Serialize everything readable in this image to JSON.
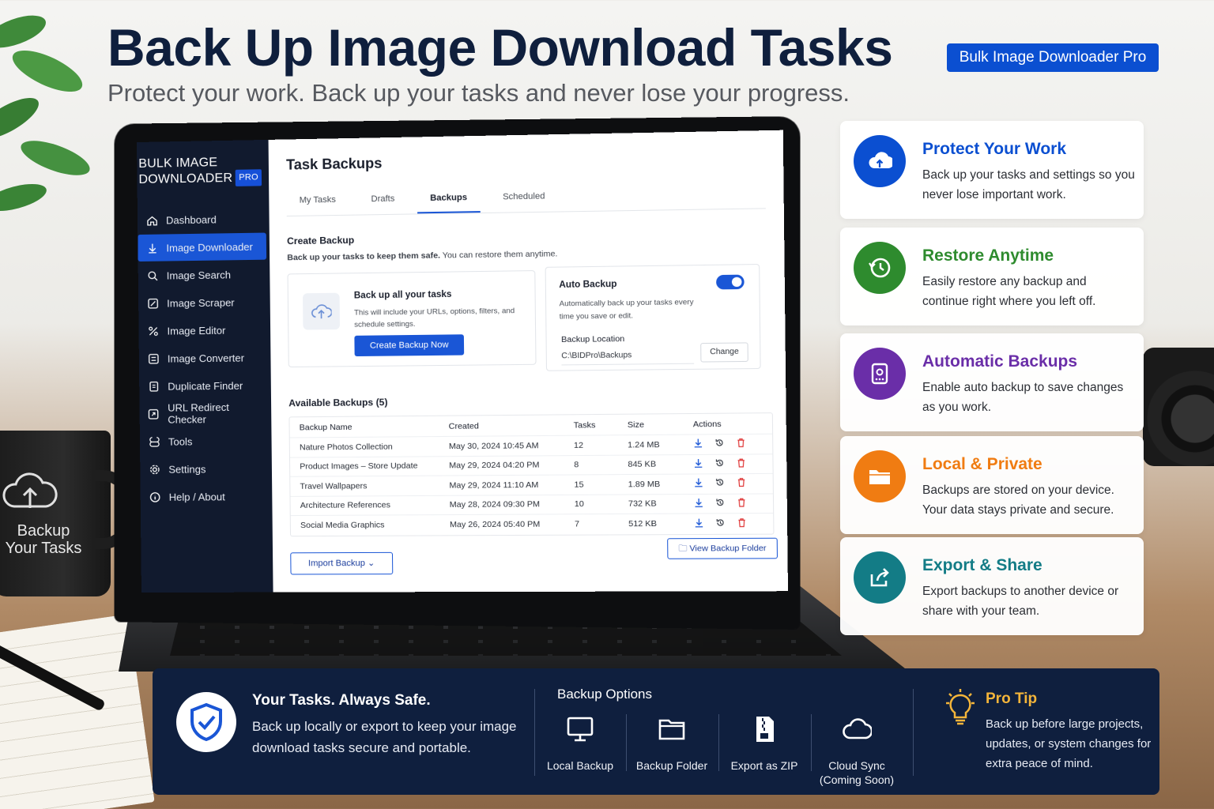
{
  "hero": {
    "title": "Back Up Image Download Tasks",
    "subtitle": "Protect your work. Back up your tasks and never lose your progress.",
    "badge": "Bulk Image Downloader Pro"
  },
  "mug": {
    "text_line1": "Backup",
    "text_line2": "Your Tasks"
  },
  "app": {
    "logo_line1": "BULK IMAGE",
    "logo_line2": "DOWNLOADER",
    "logo_badge": "PRO",
    "nav": [
      {
        "label": "Dashboard",
        "icon": "home-icon"
      },
      {
        "label": "Image Downloader",
        "icon": "download-icon",
        "active": true
      },
      {
        "label": "Image Search",
        "icon": "search-icon"
      },
      {
        "label": "Image Scraper",
        "icon": "scraper-icon"
      },
      {
        "label": "Image Editor",
        "icon": "editor-icon"
      },
      {
        "label": "Image Converter",
        "icon": "converter-icon"
      },
      {
        "label": "Duplicate Finder",
        "icon": "duplicate-icon"
      },
      {
        "label": "URL Redirect Checker",
        "icon": "link-icon"
      },
      {
        "label": "Tools",
        "icon": "tools-icon"
      },
      {
        "label": "Settings",
        "icon": "gear-icon"
      },
      {
        "label": "Help / About",
        "icon": "info-icon"
      }
    ],
    "page_title": "Task Backups",
    "tabs": [
      "My Tasks",
      "Drafts",
      "Backups",
      "Scheduled"
    ],
    "active_tab": "Backups",
    "create": {
      "title": "Create Backup",
      "subtitle_bold": "Back up your tasks to keep them safe.",
      "subtitle_rest": " You can restore them anytime.",
      "card_title": "Back up all your tasks",
      "card_desc": "This will include your URLs, options, filters, and schedule settings.",
      "button": "Create Backup Now"
    },
    "auto": {
      "title": "Auto Backup",
      "enabled": true,
      "desc": "Automatically back up your tasks every time you save or edit.",
      "location_label": "Backup Location",
      "location_value": "C:\\BIDPro\\Backups",
      "change_button": "Change"
    },
    "available_title": "Available Backups (5)",
    "table": {
      "headers": [
        "Backup Name",
        "Created",
        "Tasks",
        "Size",
        "Actions"
      ],
      "rows": [
        {
          "name": "Nature Photos Collection",
          "created": "May 30, 2024 10:45 AM",
          "tasks": "12",
          "size": "1.24 MB"
        },
        {
          "name": "Product Images – Store Update",
          "created": "May 29, 2024 04:20 PM",
          "tasks": "8",
          "size": "845 KB"
        },
        {
          "name": "Travel Wallpapers",
          "created": "May 29, 2024 11:10 AM",
          "tasks": "15",
          "size": "1.89 MB"
        },
        {
          "name": "Architecture References",
          "created": "May 28, 2024 09:30 PM",
          "tasks": "10",
          "size": "732 KB"
        },
        {
          "name": "Social Media Graphics",
          "created": "May 26, 2024 05:40 PM",
          "tasks": "7",
          "size": "512 KB"
        }
      ]
    },
    "import_button": "Import Backup",
    "view_folder_button": "View Backup Folder"
  },
  "features": [
    {
      "title": "Protect Your Work",
      "desc": "Back up your tasks and settings so you never lose important work.",
      "color": "#0b4fd1",
      "icon": "cloud-upload-icon"
    },
    {
      "title": "Restore Anytime",
      "desc": "Easily restore any backup and continue right where you left off.",
      "color": "#2e8b2e",
      "icon": "restore-clock-icon"
    },
    {
      "title": "Automatic Backups",
      "desc": "Enable auto backup to save changes as you work.",
      "color": "#6a2ea8",
      "icon": "drive-icon"
    },
    {
      "title": "Local & Private",
      "desc": "Backups are stored on your device. Your data stays private and secure.",
      "color": "#f07c12",
      "icon": "folder-icon"
    },
    {
      "title": "Export & Share",
      "desc": "Export backups to another device or share with your team.",
      "color": "#137c86",
      "icon": "share-icon"
    }
  ],
  "banner": {
    "title": "Your Tasks. Always Safe.",
    "desc": "Back up locally or export to keep your image download tasks secure and portable.",
    "options_title": "Backup Options",
    "options": [
      {
        "label": "Local Backup",
        "icon": "monitor-icon"
      },
      {
        "label": "Backup Folder",
        "icon": "folder-icon"
      },
      {
        "label": "Export as ZIP",
        "icon": "zip-icon"
      },
      {
        "label": "Cloud Sync (Coming Soon)",
        "icon": "cloud-icon"
      }
    ],
    "tip_title": "Pro Tip",
    "tip_desc": "Back up before large projects, updates, or system changes for extra peace of mind."
  }
}
